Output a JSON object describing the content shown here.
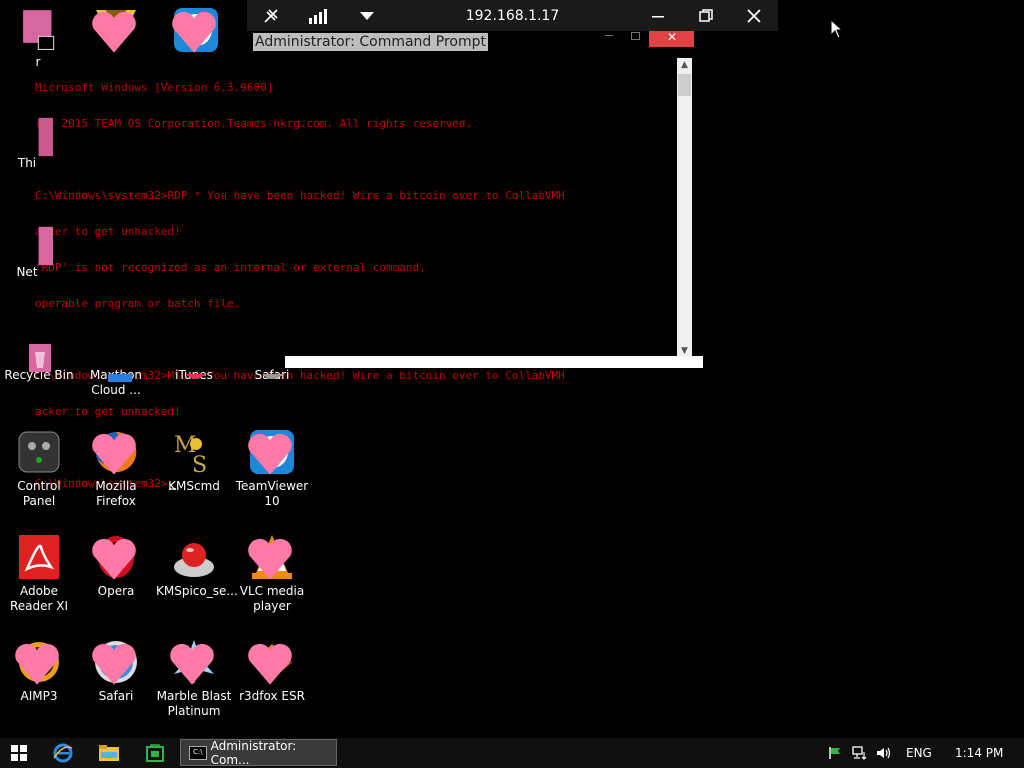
{
  "remote_toolbar": {
    "title": "192.168.1.17"
  },
  "cmd": {
    "title": "Administrator: Command Prompt",
    "close_label": "✕",
    "lines": [
      "Microsoft Windows [Version 6.3.9600]",
      "(c) 2015 TEAM OS Corporation.Teamos-hkrg.com. All rights reserved.",
      "",
      "C:\\Windows\\system32>RDP * You have been hacked! Wire a bitcoin over to CollabVMH",
      "acker to get unhacked!",
      "'RDP' is not recognized as an internal or external command,",
      "operable program or batch file.",
      "",
      "C:\\Windows\\system32>MSG * You have been hacked! Wire a bitcoin over to CollabVMH",
      "acker to get unhacked!",
      "",
      "C:\\Windows\\system32>"
    ]
  },
  "desktop": {
    "partial_labels": {
      "this_pc": "Thi",
      "network": "Net",
      "top_left": "r"
    },
    "icons": [
      {
        "label": "Recycle Bin",
        "icon": "recycle-bin-icon"
      },
      {
        "label": "Maxthon Cloud ...",
        "icon": "maxthon-icon"
      },
      {
        "label": "iTunes",
        "icon": "itunes-icon"
      },
      {
        "label": "Safari",
        "icon": "safari-icon"
      },
      {
        "label": "Control Panel",
        "icon": "control-panel-icon"
      },
      {
        "label": "Mozilla Firefox",
        "icon": "firefox-icon"
      },
      {
        "label": "KMScmd",
        "icon": "kmscmd-icon"
      },
      {
        "label": "TeamViewer 10",
        "icon": "teamviewer-icon"
      },
      {
        "label": "Adobe Reader XI",
        "icon": "adobe-reader-icon"
      },
      {
        "label": "Opera",
        "icon": "opera-icon"
      },
      {
        "label": "KMSpico_se...",
        "icon": "kmspico-icon"
      },
      {
        "label": "VLC media player",
        "icon": "vlc-icon"
      },
      {
        "label": "AIMP3",
        "icon": "aimp-icon"
      },
      {
        "label": "Safari",
        "icon": "safari-icon"
      },
      {
        "label": "Marble Blast Platinum",
        "icon": "marble-blast-icon"
      },
      {
        "label": "r3dfox ESR",
        "icon": "r3dfox-icon"
      }
    ]
  },
  "taskbar": {
    "active_window": "Administrator: Com...",
    "language": "ENG",
    "time": "1:14 PM"
  }
}
